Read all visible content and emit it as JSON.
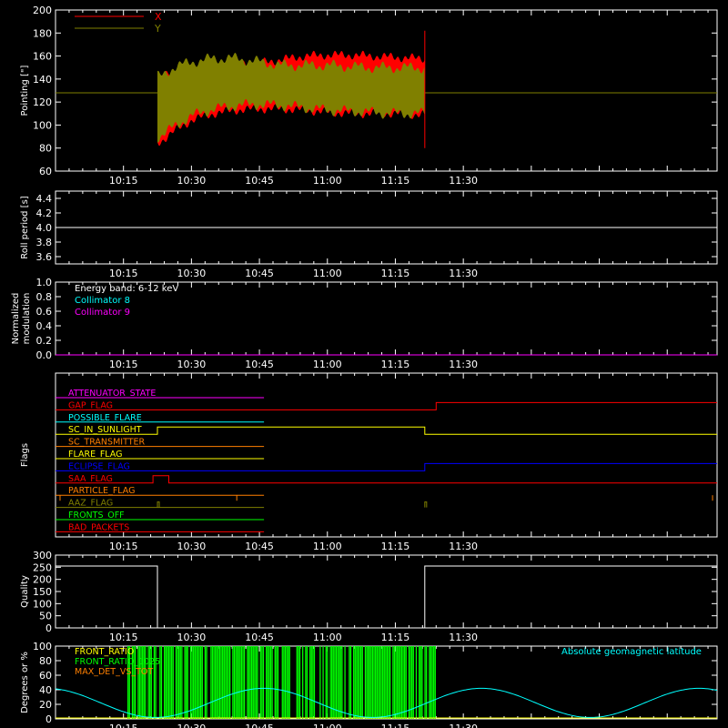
{
  "chart_data": [
    {
      "type": "line",
      "ylabel": "Pointing [\"]",
      "ylim": [
        60,
        200
      ],
      "yticks": [
        60,
        80,
        100,
        120,
        140,
        160,
        180,
        200
      ],
      "xticks": [
        "10:15",
        "10:30",
        "10:45",
        "11:00",
        "11:15",
        "11:30"
      ],
      "xlim_min": [
        600,
        646
      ],
      "legend_position": "top-left",
      "series": [
        {
          "name": "X",
          "color": "#ff0000",
          "baseline": 128,
          "start_min": 622.5,
          "end_min": 681.5,
          "envelope_min": [
            [
              623,
              85
            ],
            [
              626,
              94
            ],
            [
              630,
              104
            ],
            [
              635,
              110
            ],
            [
              640,
              113
            ],
            [
              645,
              114
            ],
            [
              650,
              114
            ],
            [
              655,
              113
            ],
            [
              660,
              111
            ],
            [
              665,
              110
            ],
            [
              670,
              110
            ],
            [
              675,
              110
            ],
            [
              680,
              109
            ]
          ],
          "envelope_max": [
            [
              623,
              140
            ],
            [
              626,
              147
            ],
            [
              630,
              150
            ],
            [
              635,
              152
            ],
            [
              640,
              153
            ],
            [
              645,
              154
            ],
            [
              650,
              157
            ],
            [
              655,
              160
            ],
            [
              660,
              161
            ],
            [
              665,
              161
            ],
            [
              670,
              160
            ],
            [
              675,
              159
            ],
            [
              680,
              158
            ]
          ]
        },
        {
          "name": "Y",
          "color": "#808000",
          "baseline": 128,
          "start_min": 622.5,
          "end_min": 681.5,
          "envelope_min": [
            [
              623,
              90
            ],
            [
              626,
              98
            ],
            [
              630,
              108
            ],
            [
              635,
              114
            ],
            [
              640,
              117
            ],
            [
              645,
              118
            ],
            [
              650,
              117
            ],
            [
              655,
              115
            ],
            [
              660,
              113
            ],
            [
              665,
              112
            ],
            [
              670,
              111
            ],
            [
              675,
              110
            ],
            [
              680,
              110
            ]
          ],
          "envelope_max": [
            [
              623,
              142
            ],
            [
              626,
              150
            ],
            [
              630,
              155
            ],
            [
              635,
              158
            ],
            [
              640,
              158
            ],
            [
              645,
              155
            ],
            [
              650,
              152
            ],
            [
              655,
              152
            ],
            [
              660,
              152
            ],
            [
              665,
              151
            ],
            [
              670,
              150
            ],
            [
              675,
              150
            ],
            [
              680,
              150
            ]
          ]
        }
      ]
    },
    {
      "type": "line",
      "ylabel": "Roll period [s]",
      "ylim": [
        3.5,
        4.5
      ],
      "yticks": [
        "3.6",
        "3.8",
        "4.0",
        "4.2",
        "4.4"
      ],
      "series": [
        {
          "color": "#ffffff",
          "constant": 4.0
        }
      ]
    },
    {
      "type": "line",
      "ylabel": "Normalized modulation",
      "ylim": [
        0,
        1
      ],
      "yticks": [
        "0.0",
        "0.2",
        "0.4",
        "0.6",
        "0.8",
        "1.0"
      ],
      "annotations": [
        {
          "text": "Energy band: 6-12 keV",
          "color": "#ffffff"
        },
        {
          "text": "Collimator 8",
          "color": "#00ffff"
        },
        {
          "text": "Collimator 9",
          "color": "#ff00ff"
        }
      ],
      "series": [
        {
          "color": "#ff00ff",
          "constant": 0.0
        }
      ]
    },
    {
      "type": "line",
      "ylabel": "Flags",
      "flags": [
        {
          "name": "ATTENUATOR_STATE",
          "color": "#ff00ff",
          "segments": [
            [
              600,
              646,
              0
            ]
          ]
        },
        {
          "name": "GAP_FLAG",
          "color": "#ff0000",
          "segments": [
            [
              600,
              684,
              0
            ],
            [
              684,
              746,
              1
            ]
          ]
        },
        {
          "name": "POSSIBLE_FLARE",
          "color": "#00ffff",
          "segments": [
            [
              600,
              646,
              0
            ]
          ]
        },
        {
          "name": "SC_IN_SUNLIGHT",
          "color": "#ffff00",
          "segments": [
            [
              600,
              622.5,
              0
            ],
            [
              622.5,
              681.5,
              1
            ],
            [
              681.5,
              746,
              0
            ]
          ]
        },
        {
          "name": "SC_TRANSMITTER",
          "color": "#ff7f00",
          "segments": [
            [
              600,
              646,
              0
            ]
          ]
        },
        {
          "name": "FLARE_FLAG",
          "color": "#ffff00",
          "segments": [
            [
              600,
              646,
              0
            ]
          ]
        },
        {
          "name": "ECLIPSE_FLAG",
          "color": "#0000ff",
          "segments": [
            [
              600,
              681.5,
              0
            ],
            [
              681.5,
              746,
              1
            ]
          ]
        },
        {
          "name": "SAA_FLAG",
          "color": "#ff0000",
          "segments": [
            [
              600,
              621.5,
              0
            ],
            [
              621.5,
              625,
              1
            ],
            [
              625,
              746,
              0
            ]
          ]
        },
        {
          "name": "PARTICLE_FLAG",
          "color": "#ff7f00",
          "segments": [
            [
              600,
              646,
              0
            ]
          ]
        },
        {
          "name": "AAZ_FLAG",
          "color": "#808000",
          "segments": [
            [
              600,
              646,
              0
            ]
          ]
        },
        {
          "name": "FRONTS_OFF",
          "color": "#00ff00",
          "segments": [
            [
              600,
              646,
              0
            ]
          ]
        },
        {
          "name": "BAD_PACKETS",
          "color": "#ff0000",
          "segments": [
            [
              600,
              646,
              0
            ]
          ]
        }
      ]
    },
    {
      "type": "line",
      "ylabel": "Quality",
      "ylim": [
        0,
        300
      ],
      "yticks": [
        "0",
        "50",
        "100",
        "150",
        "200",
        "250",
        "300"
      ],
      "series": [
        {
          "color": "#ffffff",
          "segments": [
            [
              600,
              622.5,
              255
            ],
            [
              622.5,
              681.5,
              0
            ],
            [
              681.5,
              746,
              255
            ]
          ]
        }
      ]
    },
    {
      "type": "area",
      "ylabel": "Degrees or %",
      "ylim": [
        0,
        100
      ],
      "yticks": [
        "0",
        "20",
        "40",
        "60",
        "80",
        "100"
      ],
      "legend": [
        {
          "name": "FRONT_RATIO",
          "color": "#ffff00"
        },
        {
          "name": "FRONT_RATIO_1025",
          "color": "#00ff00"
        },
        {
          "name": "MAX_DET_VS_TOT",
          "color": "#ff7f00"
        }
      ],
      "right_label": {
        "text": "Absolute geomagnetic latitude",
        "color": "#00ffff"
      },
      "green_fill_range": [
        616,
        684
      ],
      "latitude_curve": [
        [
          600,
          35
        ],
        [
          605,
          25
        ],
        [
          610,
          12
        ],
        [
          615,
          5
        ],
        [
          620,
          2
        ],
        [
          625,
          10
        ],
        [
          630,
          22
        ],
        [
          635,
          30
        ],
        [
          640,
          35
        ],
        [
          645,
          38
        ],
        [
          650,
          37
        ],
        [
          655,
          33
        ],
        [
          660,
          25
        ],
        [
          665,
          15
        ],
        [
          670,
          5
        ],
        [
          675,
          3
        ],
        [
          680,
          15
        ],
        [
          685,
          28
        ],
        [
          690,
          37
        ],
        [
          695,
          42
        ],
        [
          700,
          42
        ],
        [
          705,
          38
        ],
        [
          710,
          30
        ],
        [
          715,
          22
        ],
        [
          716,
          20
        ]
      ]
    }
  ]
}
